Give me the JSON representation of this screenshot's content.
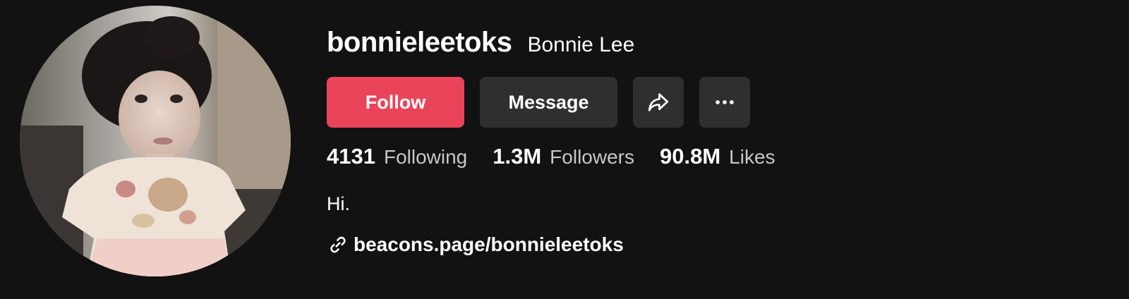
{
  "profile": {
    "username": "bonnieleetoks",
    "display_name": "Bonnie Lee",
    "avatar_icon": "profile-photo"
  },
  "actions": {
    "follow_label": "Follow",
    "message_label": "Message",
    "share_icon": "share-arrow-icon",
    "more_icon": "more-dots-icon"
  },
  "stats": [
    {
      "value": "4131",
      "label": "Following"
    },
    {
      "value": "1.3M",
      "label": "Followers"
    },
    {
      "value": "90.8M",
      "label": "Likes"
    }
  ],
  "bio": "Hi.",
  "link": {
    "icon": "link-icon",
    "text": "beacons.page/bonnieleetoks"
  },
  "colors": {
    "background": "#121212",
    "follow_button": "#ea445a",
    "secondary_button": "#2f2f2f",
    "stat_label": "#c8c8c8"
  }
}
